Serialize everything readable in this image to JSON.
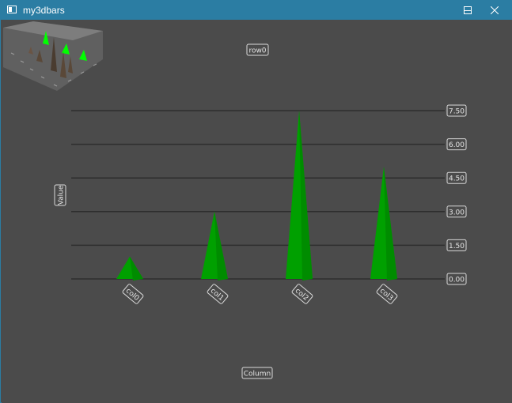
{
  "window": {
    "title": "my3dbars"
  },
  "icons": {
    "app": "window-app-icon",
    "minimize": "minimize-icon",
    "maximize": "maximize-icon",
    "close": "close-icon"
  },
  "colors": {
    "titlebar": "#2b7da3",
    "background": "#4b4b4b",
    "bars": "#00a000",
    "grid": "#2e2e2e",
    "label_border": "#d8d8d8"
  },
  "chart_data": {
    "type": "bar",
    "title": "row0",
    "xlabel": "Column",
    "ylabel": "Value",
    "categories": [
      "col0",
      "col1",
      "col2",
      "col3"
    ],
    "series": [
      {
        "name": "row0",
        "values": [
          1.0,
          3.0,
          7.5,
          5.0
        ]
      }
    ],
    "ylim": [
      0,
      7.5
    ],
    "yticks": [
      "0.00",
      "1.50",
      "3.00",
      "4.50",
      "6.00",
      "7.50"
    ],
    "grid": true,
    "bar_shape": "cone"
  }
}
